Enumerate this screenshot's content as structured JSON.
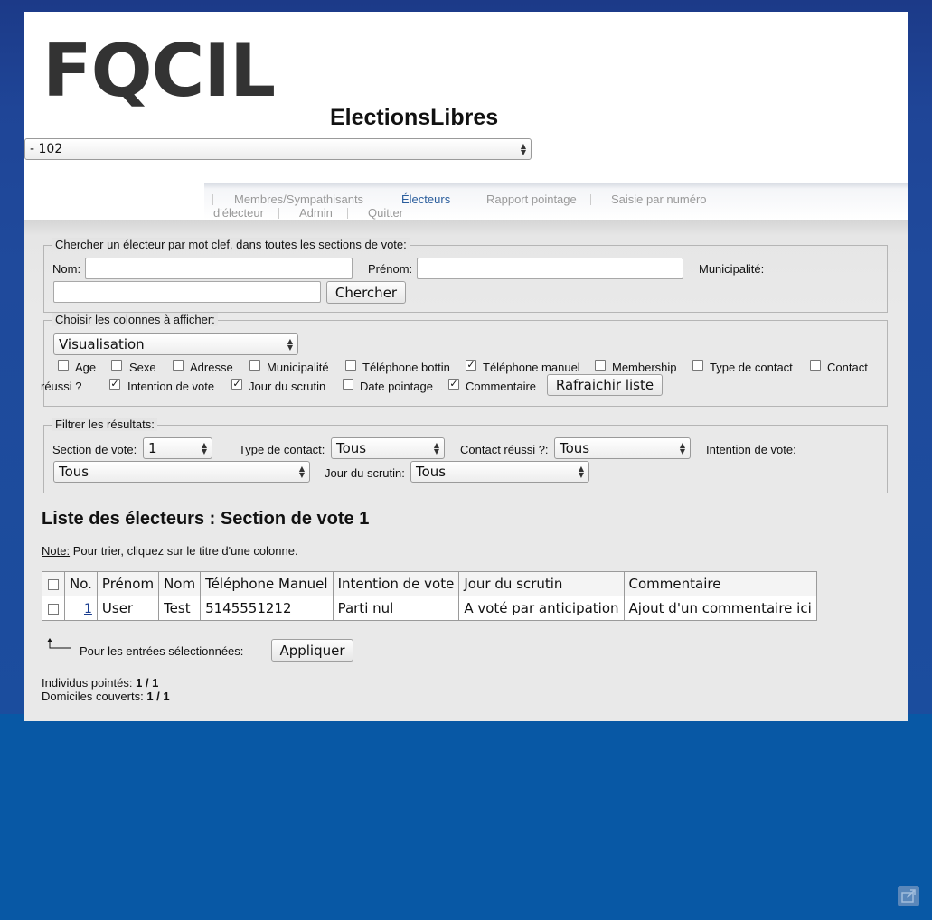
{
  "header": {
    "logo_text": "FQCIL",
    "app_title": "ElectionsLibres",
    "section_select": "- 102"
  },
  "nav": {
    "items": [
      {
        "label": "Membres/Sympathisants",
        "active": false
      },
      {
        "label": "Électeurs",
        "active": true
      },
      {
        "label": "Rapport pointage",
        "active": false
      },
      {
        "label": "Saisie par numéro",
        "active": false
      },
      {
        "label": "d'électeur",
        "active": false
      },
      {
        "label": "Admin",
        "active": false
      },
      {
        "label": "Quitter",
        "active": false
      }
    ]
  },
  "search": {
    "legend": "Chercher un électeur par mot clef, dans toutes les sections de vote:",
    "nom_label": "Nom:",
    "nom_value": "",
    "prenom_label": "Prénom:",
    "prenom_value": "",
    "municipalite_label": "Municipalité:",
    "municipalite_value": "",
    "button": "Chercher"
  },
  "columns": {
    "legend": "Choisir les colonnes à afficher:",
    "preset": "Visualisation",
    "options": [
      {
        "label": "Age",
        "checked": false
      },
      {
        "label": "Sexe",
        "checked": false
      },
      {
        "label": "Adresse",
        "checked": false
      },
      {
        "label": "Municipalité",
        "checked": false
      },
      {
        "label": "Téléphone bottin",
        "checked": false
      },
      {
        "label": "Téléphone manuel",
        "checked": true
      },
      {
        "label": "Membership",
        "checked": false
      },
      {
        "label": "Type de contact",
        "checked": false
      },
      {
        "label": "Contact",
        "checked": false
      },
      {
        "label": "réussi ?",
        "checked": null
      },
      {
        "label": "Intention de vote",
        "checked": true
      },
      {
        "label": "Jour du scrutin",
        "checked": true
      },
      {
        "label": "Date pointage",
        "checked": false
      },
      {
        "label": "Commentaire",
        "checked": true
      }
    ],
    "refresh_button": "Rafraichir liste"
  },
  "filters": {
    "legend": "Filtrer les résultats:",
    "section_label": "Section de vote:",
    "section_value": "1",
    "type_contact_label": "Type de contact:",
    "type_contact_value": "Tous",
    "contact_reussi_label": "Contact réussi ?:",
    "contact_reussi_value": "Tous",
    "intention_label": "Intention de vote:",
    "intention_value": "Tous",
    "jour_label": "Jour du scrutin:",
    "jour_value": "Tous"
  },
  "list": {
    "title": "Liste des électeurs : Section de vote 1",
    "note_label": "Note:",
    "note_text": " Pour trier, cliquez sur le titre d'une colonne.",
    "headers": [
      "No.",
      "Prénom",
      "Nom",
      "Téléphone Manuel",
      "Intention de vote",
      "Jour du scrutin",
      "Commentaire"
    ],
    "rows": [
      [
        "1",
        "User",
        "Test",
        "5145551212",
        "Parti nul",
        "A voté par anticipation",
        "Ajout d'un commentaire ici"
      ]
    ]
  },
  "bulk": {
    "label": "Pour les entrées sélectionnées:",
    "button": "Appliquer"
  },
  "stats": {
    "individus_label": "Individus pointés: ",
    "individus_value": "1 / 1",
    "domiciles_label": "Domiciles couverts: ",
    "domiciles_value": "1 / 1"
  },
  "icons": {
    "select_arrows": "updown-arrows-icon",
    "corner_arrow": "corner-up-arrow-icon",
    "share": "share-icon"
  },
  "colors": {
    "background_top": "#1c3a88",
    "background_bottom": "#0858a5",
    "nav_active": "#2a5d9c",
    "logo": "#333333"
  }
}
